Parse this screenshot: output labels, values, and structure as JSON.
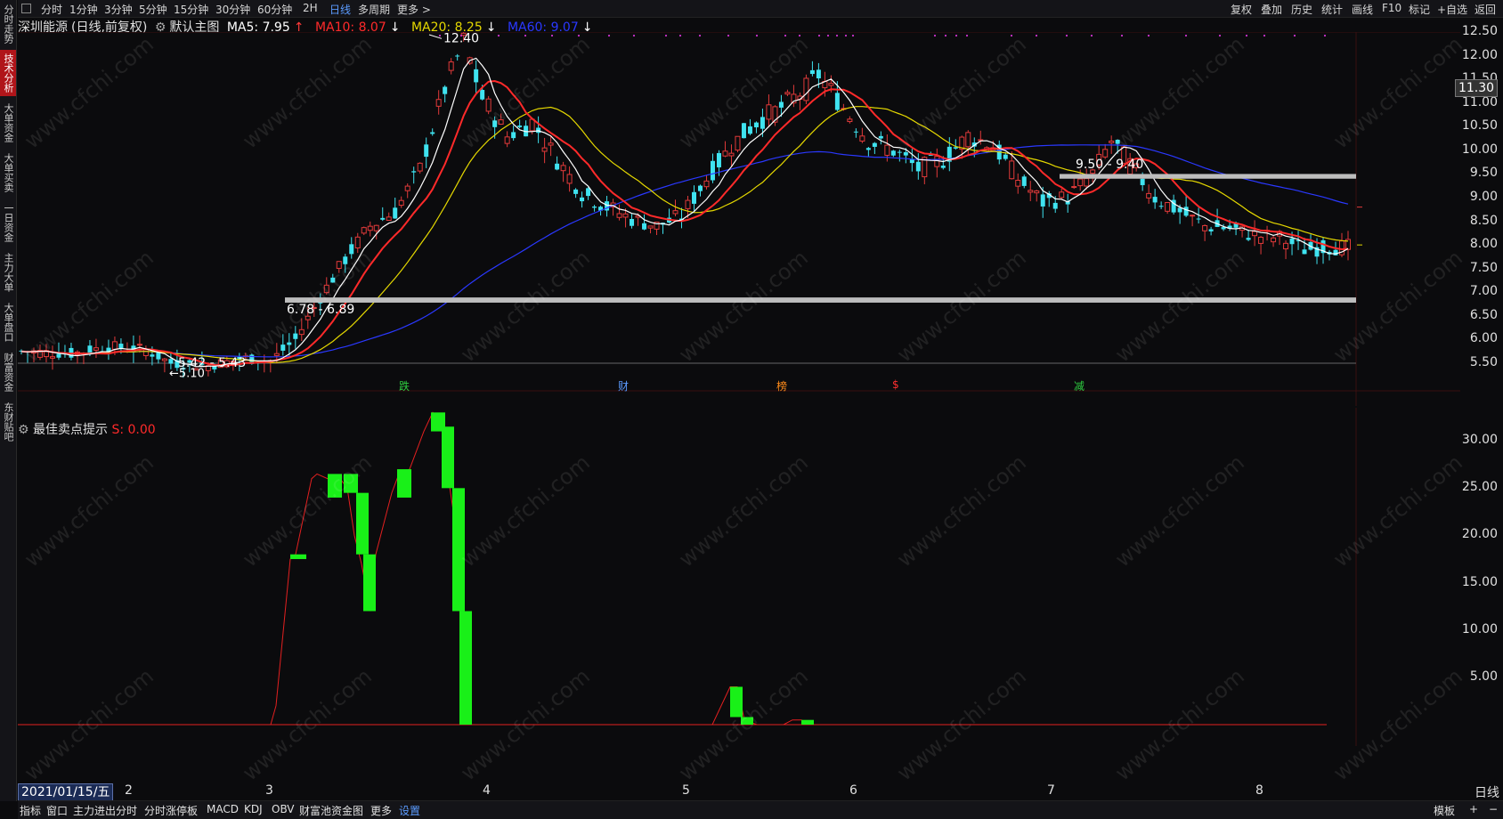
{
  "sidebar": {
    "items": [
      {
        "label": "分时走势",
        "active": false
      },
      {
        "label": "技术分析",
        "active": true
      },
      {
        "label": "大单资金",
        "active": false
      },
      {
        "label": "大单买卖",
        "active": false
      },
      {
        "label": "一日资金",
        "active": false
      },
      {
        "label": "主力大单",
        "active": false
      },
      {
        "label": "大单盘口",
        "active": false
      },
      {
        "label": "财富资金",
        "active": false
      },
      {
        "label": "东财贴吧",
        "active": false
      }
    ]
  },
  "top_tabs": {
    "left": [
      "分时",
      "1分钟",
      "3分钟",
      "5分钟",
      "15分钟",
      "30分钟",
      "60分钟",
      "2H",
      "日线",
      "多周期",
      "更多 >"
    ],
    "active": "日线",
    "right": [
      "复权",
      "叠加",
      "历史",
      "统计",
      "画线",
      "F10",
      "标记",
      "+自选",
      "返回"
    ]
  },
  "header": {
    "stock_name": "深圳能源",
    "mode": "(日线,前复权)",
    "main_chart": "默认主图",
    "ma5": "MA5: 7.95",
    "ma5_arrow": "↑",
    "ma10": "MA10: 8.07",
    "ma10_arrow": "↓",
    "ma20": "MA20: 8.25",
    "ma20_arrow": "↓",
    "ma60": "MA60: 9.07",
    "ma60_arrow": "↓"
  },
  "colors": {
    "up": "#e23a3a",
    "down": "#3fe3f0",
    "ma5": "#ffffff",
    "ma10": "#ff2a2a",
    "ma20": "#e5d800",
    "ma60": "#2a38ff",
    "signal_bar": "#19f018",
    "signal_line": "#e32020"
  },
  "price_axis": {
    "ticks": [
      "12.50",
      "12.00",
      "11.50",
      "11.00",
      "10.50",
      "10.00",
      "9.50",
      "9.00",
      "8.50",
      "8.00",
      "7.50",
      "7.00",
      "6.50",
      "6.00",
      "5.50"
    ],
    "current": "11.30"
  },
  "annotations": {
    "high": "12.40",
    "low": "5.10",
    "zone_low": "5.42 - 5.43",
    "zone_mid": "6.78 - 6.89",
    "zone_high": "9.50 - 9.40"
  },
  "event_marks": [
    "跌",
    "财",
    "榜",
    "$",
    "减"
  ],
  "indicator": {
    "name": "最佳卖点提示",
    "value": "S: 0.00",
    "ticks": [
      "30.00",
      "25.00",
      "20.00",
      "15.00",
      "10.00",
      "5.00"
    ]
  },
  "x_axis": {
    "date": "2021/01/15/五",
    "labels": [
      "2",
      "3",
      "4",
      "5",
      "6",
      "7",
      "8"
    ],
    "period": "日线"
  },
  "bottom_tabs": [
    "指标",
    "窗口",
    "主力进出分时",
    "分时涨停板",
    "MACD",
    "KDJ",
    "OBV",
    "财富池资金图",
    "更多",
    "设置"
  ],
  "bottom_active": "设置",
  "bottom_right": {
    "label": "模板",
    "plus": "+",
    "minus": "−"
  },
  "watermark": "www.cfchi.com"
}
